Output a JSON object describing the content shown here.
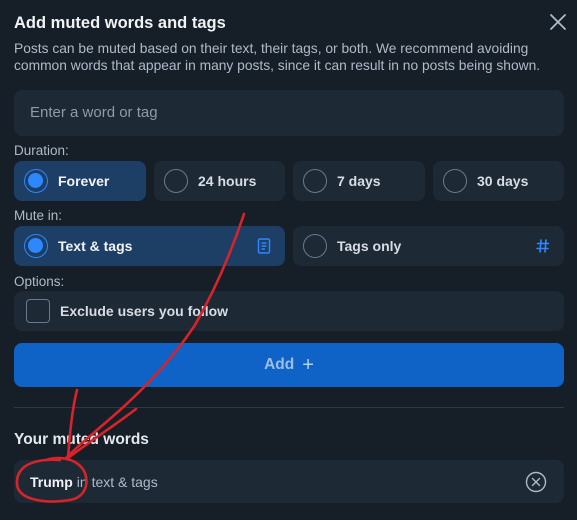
{
  "dialog": {
    "title": "Add muted words and tags",
    "description": "Posts can be muted based on their text, their tags, or both. We recommend avoiding common words that appear in many posts, since it can result in no posts being shown.",
    "close_icon": "close-icon"
  },
  "search": {
    "placeholder": "Enter a word or tag",
    "value": ""
  },
  "duration": {
    "label": "Duration:",
    "options": [
      {
        "label": "Forever",
        "selected": true
      },
      {
        "label": "24 hours",
        "selected": false
      },
      {
        "label": "7 days",
        "selected": false
      },
      {
        "label": "30 days",
        "selected": false
      }
    ]
  },
  "mute_in": {
    "label": "Mute in:",
    "options": [
      {
        "label": "Text & tags",
        "selected": true,
        "icon": "document-icon"
      },
      {
        "label": "Tags only",
        "selected": false,
        "icon": "hashtag-icon"
      }
    ]
  },
  "options": {
    "label": "Options:",
    "exclude_following": {
      "label": "Exclude users you follow",
      "checked": false
    }
  },
  "add_button": {
    "label": "Add",
    "icon": "plus"
  },
  "muted_words": {
    "title": "Your muted words",
    "items": [
      {
        "word": "Trump",
        "scope": "in text & tags"
      }
    ]
  },
  "colors": {
    "background": "#161e27",
    "field": "#1e2936",
    "selected": "#1d3e65",
    "accent": "#2d88ff",
    "button": "#0f62c6",
    "annotation": "#d8232a"
  }
}
